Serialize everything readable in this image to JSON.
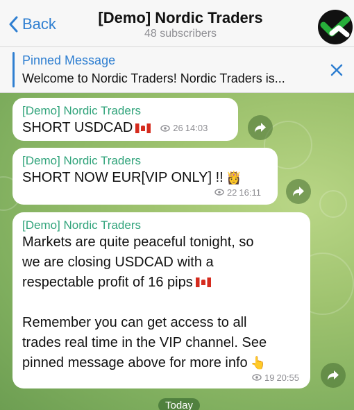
{
  "header": {
    "back_label": "Back",
    "title": "[Demo] Nordic Traders",
    "subtitle": "48 subscribers"
  },
  "pinned": {
    "title": "Pinned Message",
    "text": "Welcome to Nordic Traders! Nordic Traders is..."
  },
  "messages": [
    {
      "sender": "[Demo] Nordic Traders",
      "text": "SHORT USDCAD",
      "views": "26",
      "time": "14:03"
    },
    {
      "sender": "[Demo] Nordic Traders",
      "text": "SHORT NOW EUR[VIP ONLY] !!",
      "views": "22",
      "time": "16:11"
    },
    {
      "sender": "[Demo] Nordic Traders",
      "lines": [
        "Markets are quite peaceful tonight, so",
        "we are closing USDCAD with a",
        "respectable profit of 16 pips",
        "",
        "Remember you can get access to all",
        "trades real time in the VIP channel. See",
        "pinned message above for more info"
      ],
      "views": "19",
      "time": "20:55"
    }
  ],
  "date_separator": "Today",
  "icons": {
    "back": "chevron-left-icon",
    "close": "close-icon",
    "share": "share-arrow-icon",
    "views": "eye-icon"
  },
  "colors": {
    "accent": "#2f7fd1",
    "sender": "#2fa37a",
    "chat_bg": "#9fc36f"
  }
}
